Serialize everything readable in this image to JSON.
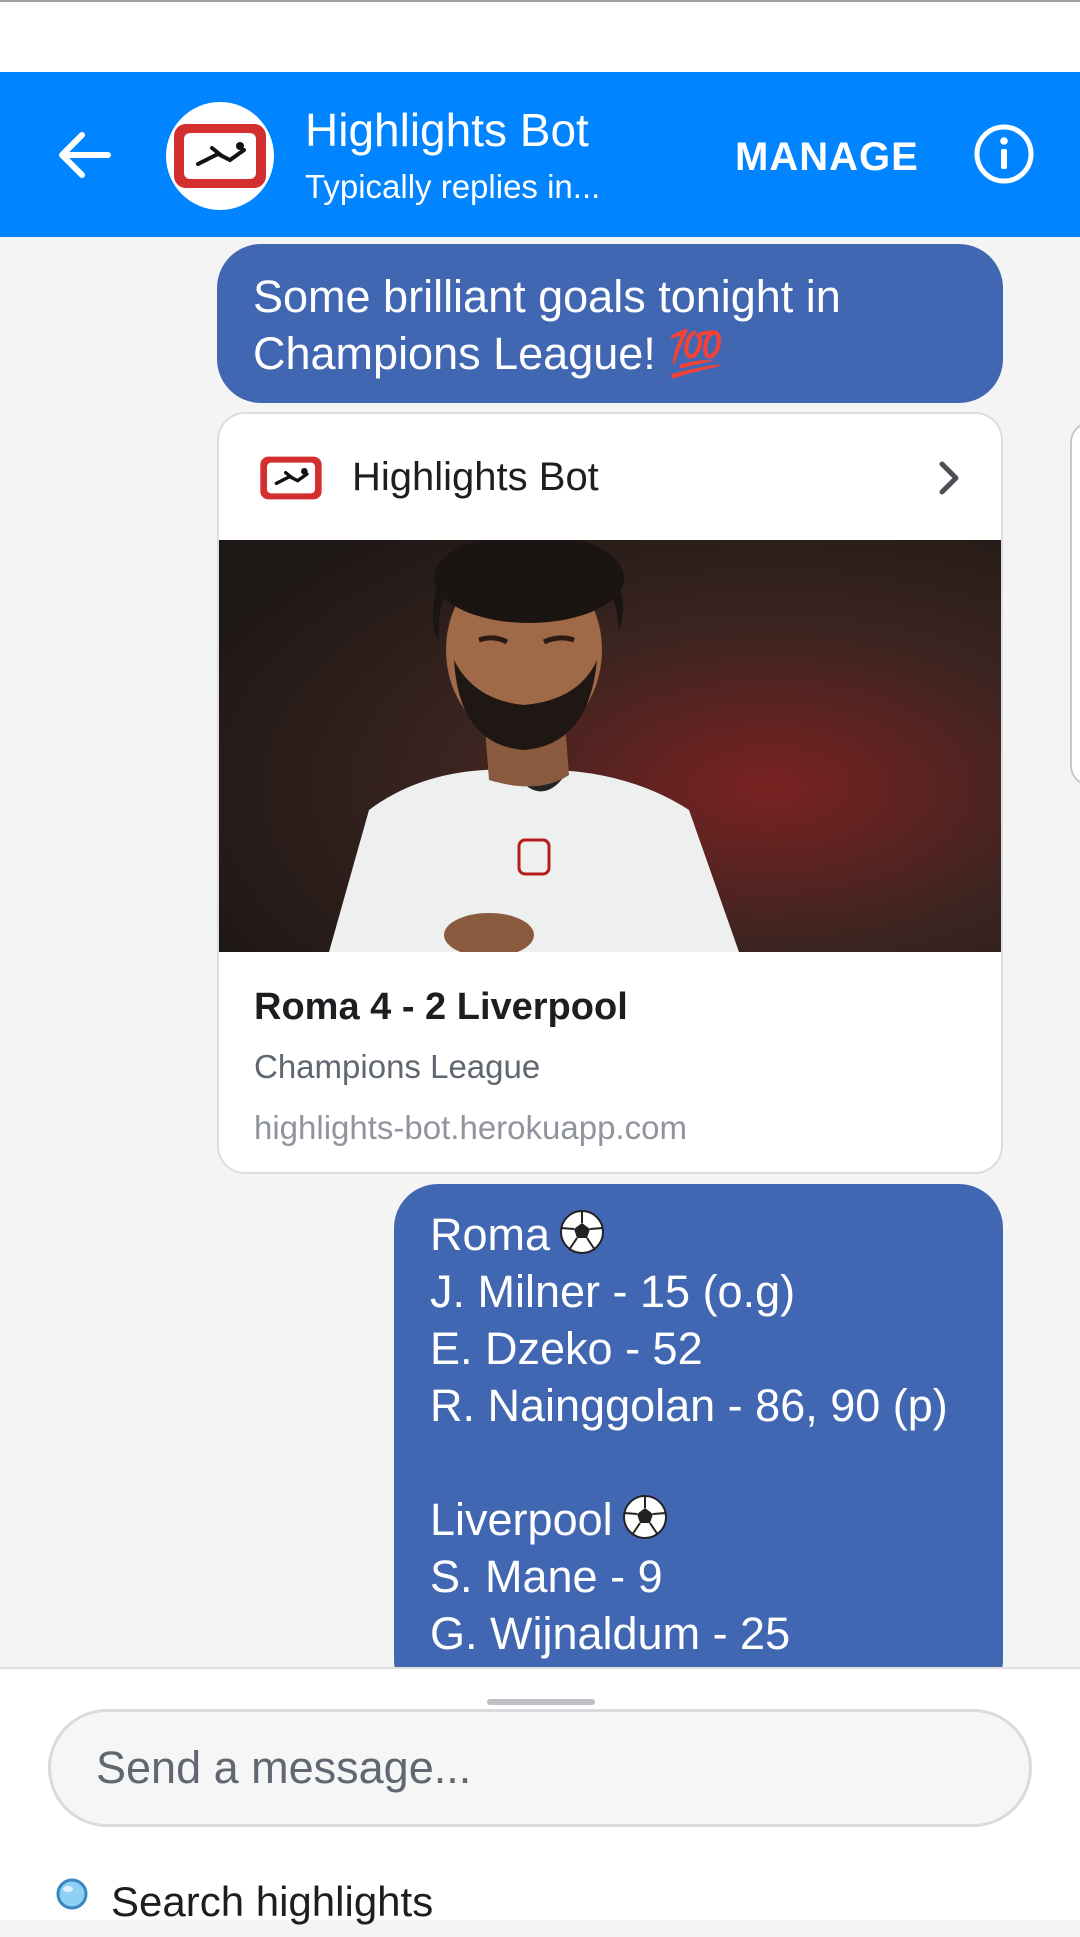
{
  "header": {
    "title": "Highlights Bot",
    "subtitle": "Typically replies in...",
    "manage_label": "MANAGE",
    "background": "#0084ff"
  },
  "messages": [
    {
      "type": "text",
      "text": "Some brilliant goals tonight in Champions League! ",
      "emoji": "💯"
    },
    {
      "type": "card",
      "header_title": "Highlights Bot",
      "title": "Roma 4 - 2 Liverpool",
      "subtitle": "Champions League",
      "url": "highlights-bot.herokuapp.com",
      "image_icon": "player-photo"
    },
    {
      "type": "text",
      "lines": [
        "Roma",
        "J. Milner - 15 (o.g)",
        "E. Dzeko - 52",
        "R. Nainggolan - 86, 90 (p)",
        "",
        "Liverpool",
        "S. Mane - 9",
        "G. Wijnaldum - 25"
      ]
    }
  ],
  "composer": {
    "placeholder": "Send a message...",
    "quick_reply": "Search highlights"
  },
  "colors": {
    "bubble": "#4267b2",
    "chat_background": "#f4f4f5"
  }
}
